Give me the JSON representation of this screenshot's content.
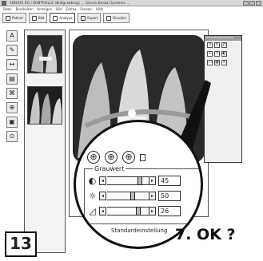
{
  "window": {
    "title": "SIDEXIS XG / KONTROLLE (Bildgrabbing) ...   Sirona Dental Systems ..."
  },
  "menubar": {
    "items": [
      "Datei",
      "Bearbeiten",
      "Anzeigen",
      "Bild",
      "Extras",
      "Fenster",
      "Hilfe"
    ]
  },
  "toolbar": {
    "buttons": [
      "Patient",
      "Bild",
      "Analyse",
      "Export",
      "Drucken"
    ]
  },
  "left_tools": [
    "A",
    "✎",
    "↔",
    "▤",
    "⌘",
    "⊕",
    "▣",
    "⊙"
  ],
  "dialog": {
    "title": "Grafik-Bildbearbeitung"
  },
  "lens": {
    "group_label": "Grauwert",
    "sliders": [
      {
        "icon": "◐",
        "value": "45",
        "level": 0.82
      },
      {
        "icon": "☼",
        "value": "50",
        "level": 0.62
      },
      {
        "icon": "◿",
        "value": "26",
        "level": 0.78
      }
    ],
    "bottom_label": "Standardeinstellung"
  },
  "badge": {
    "number": "13"
  },
  "caption": {
    "text": "7. OK ?"
  },
  "colors": {
    "frame": "#111111",
    "dialog_bg": "#efefef",
    "xray_dark": "#2a2a2a"
  }
}
